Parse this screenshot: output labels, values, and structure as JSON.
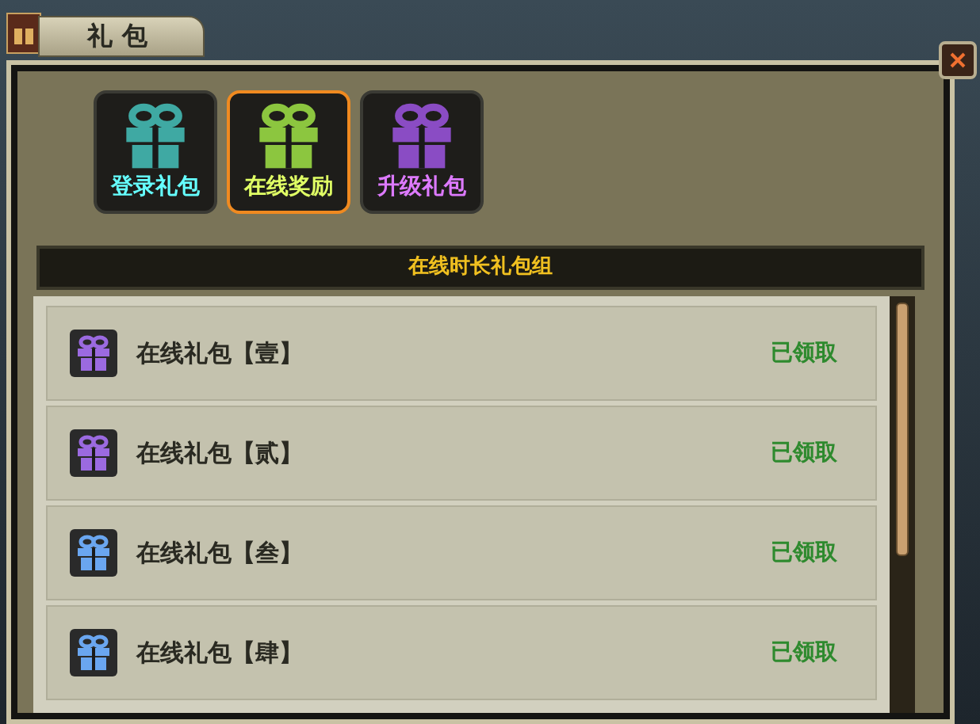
{
  "window": {
    "title": "礼包"
  },
  "tabs": [
    {
      "label": "登录礼包",
      "color": "#3fa9a3",
      "selected": false
    },
    {
      "label": "在线奖励",
      "color": "#8cc63f",
      "selected": true
    },
    {
      "label": "升级礼包",
      "color": "#8a4cc4",
      "selected": false
    }
  ],
  "section": {
    "title": "在线时长礼包组"
  },
  "items": [
    {
      "name": "在线礼包【壹】",
      "status": "已领取",
      "color": "#9b6ae0"
    },
    {
      "name": "在线礼包【贰】",
      "status": "已领取",
      "color": "#9b6ae0"
    },
    {
      "name": "在线礼包【叁】",
      "status": "已领取",
      "color": "#6aa6f0"
    },
    {
      "name": "在线礼包【肆】",
      "status": "已领取",
      "color": "#6aa6f0"
    }
  ]
}
